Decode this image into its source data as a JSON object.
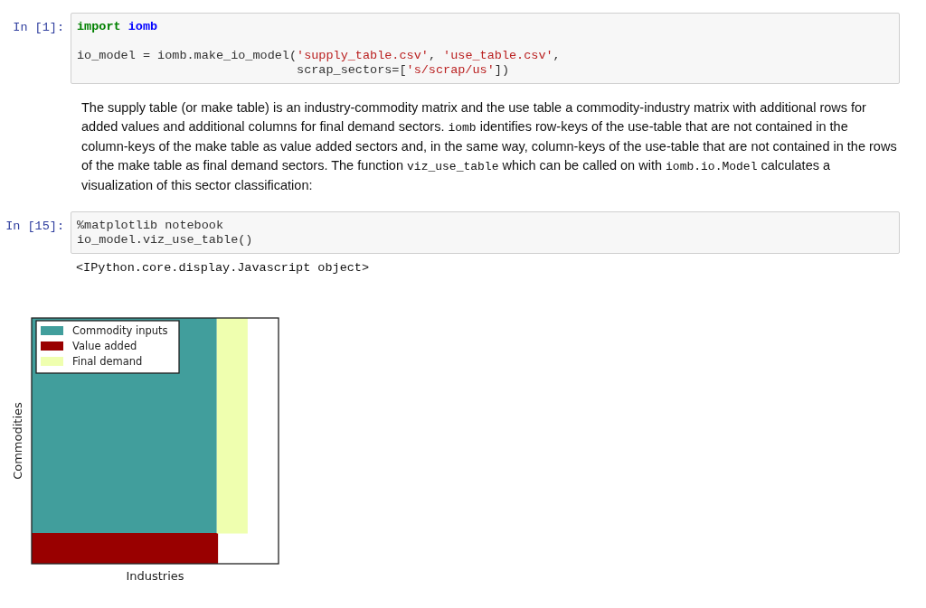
{
  "cells": [
    {
      "kind": "code",
      "prompt": "In [1]:",
      "lines": [
        {
          "tokens": [
            {
              "kind": "keyword",
              "text": "import "
            },
            {
              "kind": "module",
              "text": "iomb"
            }
          ]
        },
        {
          "blank_line_before": true,
          "tokens": [
            {
              "kind": "plain",
              "text": "io_model = iomb.make_io_model("
            },
            {
              "kind": "string",
              "text": "'supply_table.csv'"
            },
            {
              "kind": "plain",
              "text": ", "
            },
            {
              "kind": "string",
              "text": "'use_table.csv'"
            },
            {
              "kind": "plain",
              "text": ","
            }
          ]
        },
        {
          "tokens": [
            {
              "kind": "plain",
              "text": "                              scrap_sectors=["
            },
            {
              "kind": "string",
              "text": "'s/scrap/us'"
            },
            {
              "kind": "plain",
              "text": "])"
            }
          ]
        }
      ]
    },
    {
      "kind": "markdown",
      "segments": [
        {
          "kind": "text",
          "text": "The supply table (or make table) is an industry-commodity matrix and the use table a commodity-industry matrix with additional rows for added values and additional columns for final demand sectors. "
        },
        {
          "kind": "code",
          "text": "iomb"
        },
        {
          "kind": "text",
          "text": " identifies row-keys of the use-table that are not contained in the column-keys of the make table as value added sectors and, in the same way, column-keys of the use-table that are not contained in the rows of the make table as final demand sectors. The function "
        },
        {
          "kind": "code",
          "text": "viz_use_table"
        },
        {
          "kind": "text",
          "text": " which can be called on with "
        },
        {
          "kind": "code",
          "text": "iomb.io.Model"
        },
        {
          "kind": "text",
          "text": " calculates a visualization of this sector classification:"
        }
      ]
    },
    {
      "kind": "code",
      "prompt": "In [15]:",
      "lines": [
        {
          "tokens": [
            {
              "kind": "plain",
              "text": "%matplotlib notebook"
            }
          ]
        },
        {
          "tokens": [
            {
              "kind": "plain",
              "text": "io_model.viz_use_table()"
            }
          ]
        }
      ],
      "output": "<IPython.core.display.Javascript object>",
      "figure": {
        "xlabel": "Industries",
        "ylabel": "Commodities",
        "legend": [
          {
            "label": "Commodity inputs",
            "color": "#419e9c"
          },
          {
            "label": "Value added",
            "color": "#990000"
          },
          {
            "label": "Final demand",
            "color": "#efffaf"
          }
        ]
      }
    }
  ]
}
